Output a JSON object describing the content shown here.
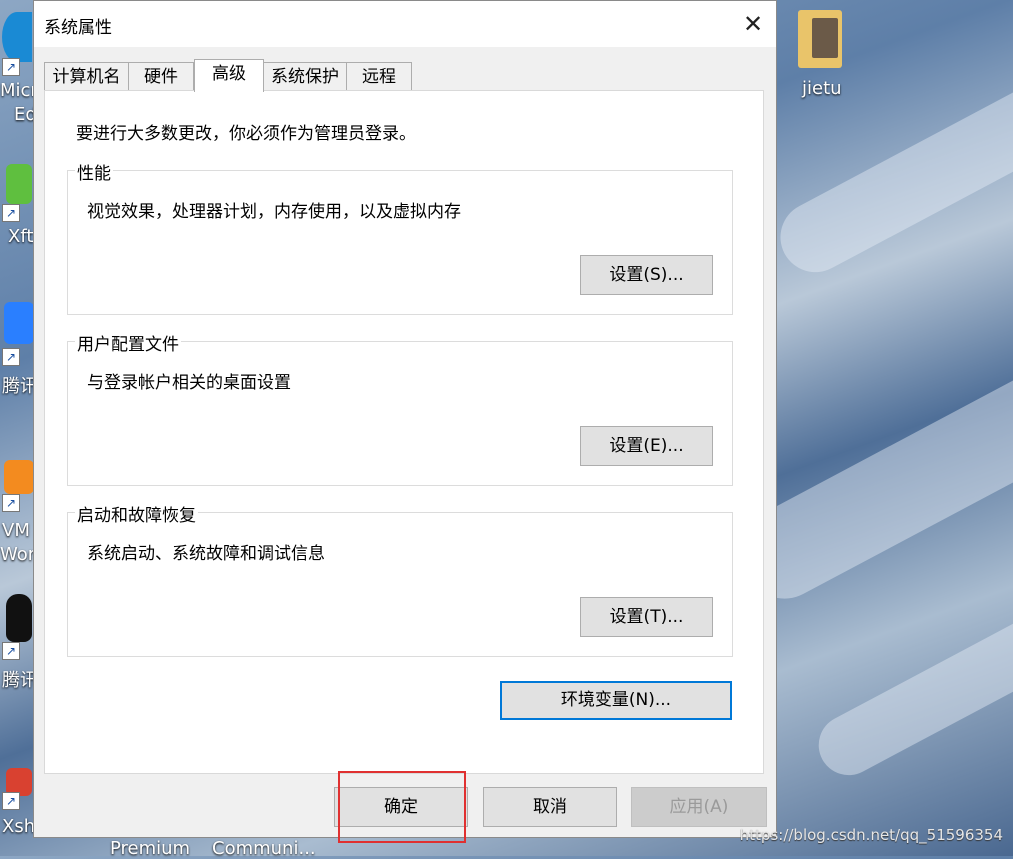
{
  "dialog": {
    "title": "系统属性",
    "close_symbol": "✕",
    "tabs": [
      "计算机名",
      "硬件",
      "高级",
      "系统保护",
      "远程"
    ],
    "active_tab": "高级",
    "admin_note": "要进行大多数更改，你必须作为管理员登录。",
    "groups": [
      {
        "title": "性能",
        "description": "视觉效果，处理器计划，内存使用，以及虚拟内存",
        "button": "设置(S)..."
      },
      {
        "title": "用户配置文件",
        "description": "与登录帐户相关的桌面设置",
        "button": "设置(E)..."
      },
      {
        "title": "启动和故障恢复",
        "description": "系统启动、系统故障和调试信息",
        "button": "设置(T)..."
      }
    ],
    "env_button": "环境变量(N)...",
    "ok_button": "确定",
    "cancel_button": "取消",
    "apply_button": "应用(A)"
  },
  "desktop": {
    "icon_labels": [
      "Micr",
      "Ed",
      "Xft",
      "腾讯",
      "VM",
      "Work",
      "腾讯",
      "Xsh",
      "jietu",
      "Premium",
      "Communi..."
    ]
  },
  "watermark": "https://blog.csdn.net/qq_51596354",
  "colors": {
    "accent": "#0078d7",
    "highlight": "#e03030"
  }
}
